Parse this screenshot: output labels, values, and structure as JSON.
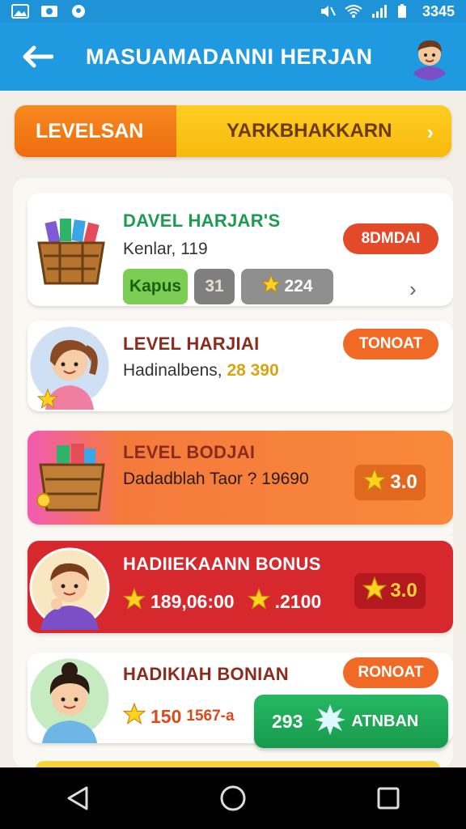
{
  "status_bar": {
    "time": "3345"
  },
  "app_bar": {
    "title": "MASUAMADANNI HERJAN"
  },
  "banner": {
    "left_label": "LEVELSAN",
    "right_label": "YARKBHAKKARN"
  },
  "cards": [
    {
      "title": "DAVEL HARJAR'S",
      "subtitle": "Kenlar, 119",
      "badge": "8DMDAI",
      "chips": [
        "Kapus",
        "31",
        "224"
      ]
    },
    {
      "title": "LEVEL HARJIAI",
      "subtitle_text": "Hadinalbens,",
      "subtitle_number": "28 390",
      "badge": "TONOAT"
    },
    {
      "title": "LEVEL BODJAI",
      "subtitle": "Dadadblah Taor ? 19690",
      "score": "3.0"
    },
    {
      "title": "HADIIEKAANN BONUS",
      "stat_1": "189,06:00",
      "stat_2": ".2100",
      "score": "3.0"
    },
    {
      "title": "HADIKIAH BONIAN",
      "stat_1": "150",
      "stat_1_suffix": "1567-a",
      "badge": "RONOAT",
      "action_number": "293",
      "action_label": "ATNBAN"
    }
  ],
  "colors": {
    "app_bar": "#1f9ae0",
    "banner_orange": "#f07012",
    "banner_yellow": "#fbc219",
    "badge_red": "#e24a2a",
    "badge_orange": "#f06a26",
    "card_orange": "#f5793a",
    "card_red": "#d7282e",
    "green": "#1eaa5a"
  }
}
